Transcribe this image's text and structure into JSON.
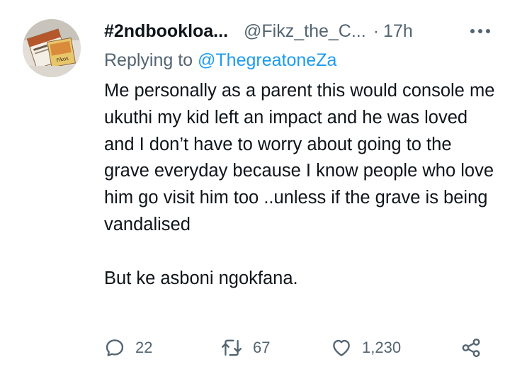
{
  "tweet": {
    "display_name": "#2ndbookloa...",
    "handle": "@Fikz_the_C...",
    "separator": "·",
    "time": "17h",
    "replying_prefix": "Replying to",
    "replying_to": "@ThegreatoneZa",
    "text": "Me personally as a parent this would console me  ukuthi my kid left an impact and he was loved and I don’t have to worry about going to the grave everyday because I know people who love him go visit him too ..unless if the grave is being vandalised\n\nBut ke asboni ngokfana.",
    "avatar_icon": "book-cover-avatar",
    "more_icon": "more-horizontal-icon"
  },
  "actions": {
    "reply": {
      "icon": "reply-icon",
      "count": "22"
    },
    "retweet": {
      "icon": "retweet-icon",
      "count": "67"
    },
    "like": {
      "icon": "heart-icon",
      "count": "1,230"
    },
    "share": {
      "icon": "share-icon"
    }
  },
  "colors": {
    "text": "#0f1419",
    "secondary": "#536471",
    "link": "#1d9bf0",
    "background": "#ffffff"
  }
}
